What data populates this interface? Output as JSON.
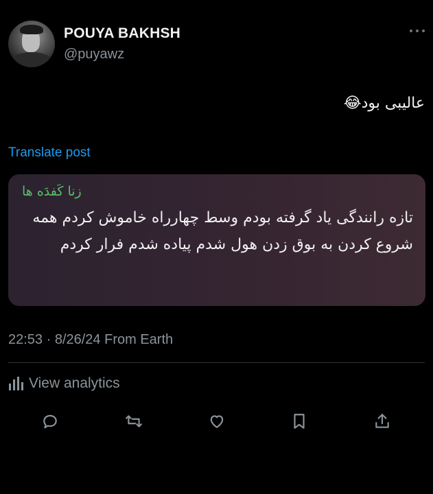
{
  "author": {
    "display_name": "POUYA BAKHSH",
    "handle": "@puyawz"
  },
  "post": {
    "text": "عالیبی بود😂",
    "translate_label": "Translate post"
  },
  "quoted": {
    "tag": "زنا کَفدَه ها",
    "body": "تازه رانندگی یاد گرفته بودم وسط چهارراه خاموش کردم همه شروع کردن به بوق زدن هول شدم پیاده شدم فرار کردم"
  },
  "meta": {
    "timestamp": "22:53 · 8/26/24 From Earth"
  },
  "analytics": {
    "label": "View analytics"
  },
  "icons": {
    "more": "more-options-icon",
    "analytics": "bar-chart-icon",
    "reply": "reply-icon",
    "repost": "repost-icon",
    "like": "heart-icon",
    "bookmark": "bookmark-icon",
    "share": "share-icon"
  },
  "colors": {
    "background": "#000000",
    "link": "#1d9bf0",
    "muted": "#8b949a",
    "quote_tag": "#55c06a",
    "quote_background": "#352531"
  }
}
